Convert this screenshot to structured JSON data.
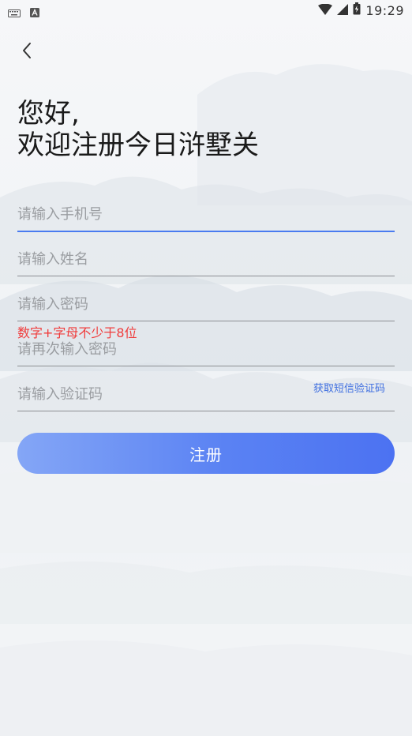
{
  "status_bar": {
    "time": "19:29",
    "icons": [
      "keyboard-icon",
      "app-notification-icon",
      "wifi-icon",
      "signal-icon",
      "battery-icon"
    ]
  },
  "header": {
    "back_icon": "chevron-left-icon"
  },
  "greeting": {
    "line1": "您好,",
    "line2": "欢迎注册今日浒墅关"
  },
  "form": {
    "phone": {
      "placeholder": "请输入手机号",
      "value": ""
    },
    "name": {
      "placeholder": "请输入姓名",
      "value": ""
    },
    "password": {
      "placeholder": "请输入密码",
      "value": "",
      "hint": "数字+字母不少于8位"
    },
    "confirm_password": {
      "placeholder": "请再次输入密码",
      "value": ""
    },
    "verification_code": {
      "placeholder": "请输入验证码",
      "value": "",
      "sms_link": "获取短信验证码"
    },
    "submit_label": "注册"
  },
  "colors": {
    "accent": "#4a7bf0",
    "error": "#f03c3c",
    "button_gradient_start": "#84a6f6",
    "button_gradient_end": "#4c72f2"
  }
}
